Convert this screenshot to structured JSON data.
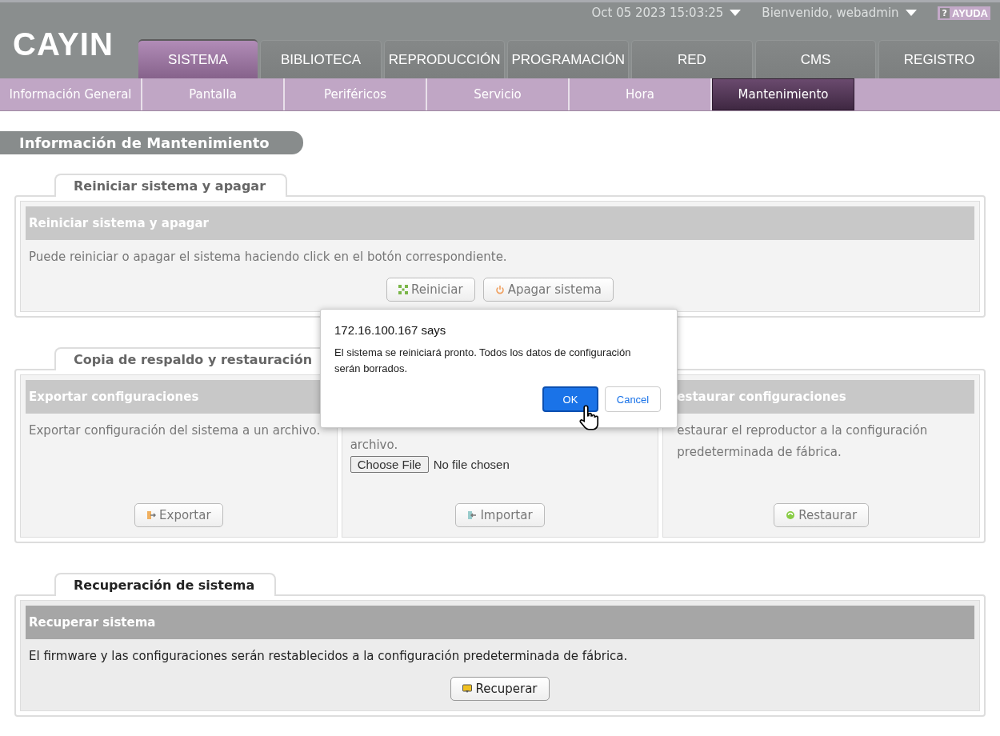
{
  "header": {
    "logo": "CAYIN",
    "datetime": "Oct 05 2023 15:03:25",
    "user": "Bienvenido, webadmin",
    "help": {
      "icon": "?",
      "label": "AYUDA"
    }
  },
  "tabs": [
    {
      "label": "SISTEMA",
      "selected": true
    },
    {
      "label": "BIBLIOTECA",
      "selected": false
    },
    {
      "label": "REPRODUCCIÓN",
      "selected": false
    },
    {
      "label": "PROGRAMACIÓN",
      "selected": false
    },
    {
      "label": "RED",
      "selected": false
    },
    {
      "label": "CMS",
      "selected": false
    },
    {
      "label": "REGISTRO",
      "selected": false
    }
  ],
  "subtabs": [
    {
      "label": "Información General",
      "selected": false
    },
    {
      "label": "Pantalla",
      "selected": false
    },
    {
      "label": "Periféricos",
      "selected": false
    },
    {
      "label": "Servicio",
      "selected": false
    },
    {
      "label": "Hora",
      "selected": false
    },
    {
      "label": "Mantenimiento",
      "selected": true
    }
  ],
  "page_title": "Información de Mantenimiento",
  "sections": [
    {
      "title": "Reiniciar sistema y apagar",
      "faded": true,
      "panels": [
        {
          "header": "Reiniciar sistema y apagar",
          "text": "Puede reiniciar o apagar el sistema haciendo click en el botón correspondiente.",
          "buttons": [
            {
              "label": "Reiniciar"
            },
            {
              "label": "Apagar sistema"
            }
          ]
        }
      ]
    },
    {
      "title": "Copia de respaldo y restauración",
      "faded": true,
      "panels": [
        {
          "header": "Exportar configuraciones",
          "text": "Exportar configuración del sistema a un archivo.",
          "buttons": [
            {
              "label": "Exportar"
            }
          ]
        },
        {
          "text": "archivo.",
          "file": {
            "button": "Choose File",
            "status": "No file chosen"
          },
          "buttons": [
            {
              "label": "Importar"
            }
          ]
        },
        {
          "header": "estaurar configuraciones",
          "text": "estaurar el reproductor a la configuración predeterminada de fábrica.",
          "buttons": [
            {
              "label": "Restaurar"
            }
          ]
        }
      ]
    },
    {
      "title": "Recuperación de sistema",
      "faded": false,
      "panels": [
        {
          "header": "Recuperar sistema",
          "text": "El firmware y las configuraciones serán restablecidos a la configuración predeterminada de fábrica.",
          "buttons": [
            {
              "label": "Recuperar"
            }
          ]
        }
      ]
    }
  ],
  "dialog": {
    "title": "172.16.100.167 says",
    "message": "El sistema se reiniciará pronto. Todos los datos de configuración serán borrados.",
    "ok": "OK",
    "cancel": "Cancel"
  }
}
